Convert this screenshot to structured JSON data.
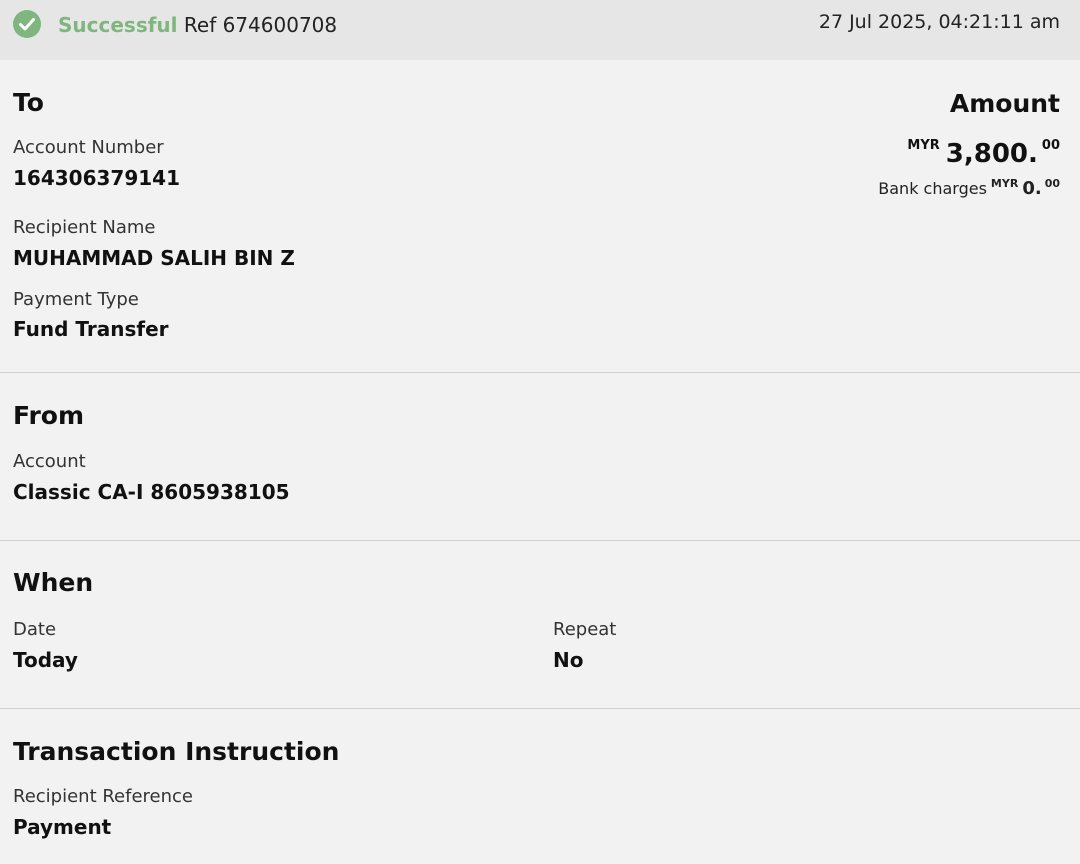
{
  "status": {
    "text": "Successful",
    "ref_label": "Ref",
    "ref_number": "674600708",
    "timestamp": "27 Jul 2025, 04:21:11 am",
    "icon": "check-circle-icon",
    "color": "#7fb67f"
  },
  "to": {
    "title": "To",
    "account_number_label": "Account Number",
    "account_number": "164306379141",
    "recipient_name_label": "Recipient Name",
    "recipient_name": "MUHAMMAD SALIH BIN Z",
    "payment_type_label": "Payment Type",
    "payment_type": "Fund Transfer"
  },
  "amount": {
    "title": "Amount",
    "currency": "MYR",
    "value": "3,800.",
    "cents": "00",
    "bank_charges_label": "Bank charges",
    "bank_charges_currency": "MYR",
    "bank_charges_value": "0.",
    "bank_charges_cents": "00"
  },
  "from": {
    "title": "From",
    "account_label": "Account",
    "account": "Classic CA-I 8605938105"
  },
  "when": {
    "title": "When",
    "date_label": "Date",
    "date": "Today",
    "repeat_label": "Repeat",
    "repeat": "No"
  },
  "instruction": {
    "title": "Transaction Instruction",
    "recipient_reference_label": "Recipient Reference",
    "recipient_reference": "Payment"
  }
}
